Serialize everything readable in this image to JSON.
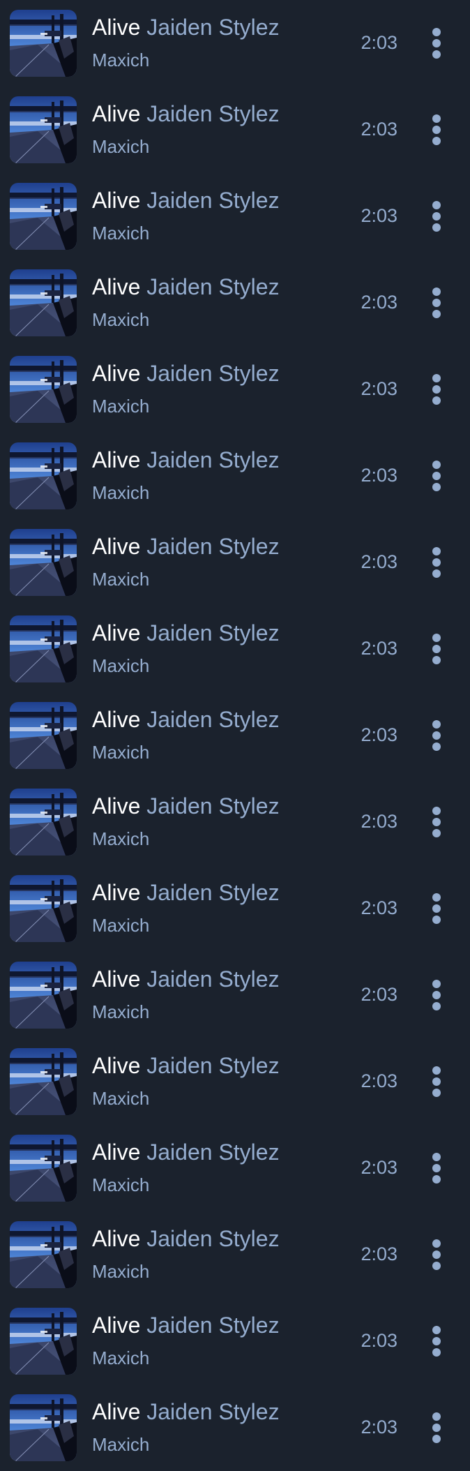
{
  "colors": {
    "background": "#1b222d",
    "title": "#ffffff",
    "secondary_text": "#95adcf"
  },
  "icons": {
    "more": "more-vertical-icon",
    "cover": "album-cover-highway"
  },
  "tracks": [
    {
      "title": "Alive",
      "featured": "Jaiden Stylez",
      "artist": "Maxich",
      "duration": "2:03"
    },
    {
      "title": "Alive",
      "featured": "Jaiden Stylez",
      "artist": "Maxich",
      "duration": "2:03"
    },
    {
      "title": "Alive",
      "featured": "Jaiden Stylez",
      "artist": "Maxich",
      "duration": "2:03"
    },
    {
      "title": "Alive",
      "featured": "Jaiden Stylez",
      "artist": "Maxich",
      "duration": "2:03"
    },
    {
      "title": "Alive",
      "featured": "Jaiden Stylez",
      "artist": "Maxich",
      "duration": "2:03"
    },
    {
      "title": "Alive",
      "featured": "Jaiden Stylez",
      "artist": "Maxich",
      "duration": "2:03"
    },
    {
      "title": "Alive",
      "featured": "Jaiden Stylez",
      "artist": "Maxich",
      "duration": "2:03"
    },
    {
      "title": "Alive",
      "featured": "Jaiden Stylez",
      "artist": "Maxich",
      "duration": "2:03"
    },
    {
      "title": "Alive",
      "featured": "Jaiden Stylez",
      "artist": "Maxich",
      "duration": "2:03"
    },
    {
      "title": "Alive",
      "featured": "Jaiden Stylez",
      "artist": "Maxich",
      "duration": "2:03"
    },
    {
      "title": "Alive",
      "featured": "Jaiden Stylez",
      "artist": "Maxich",
      "duration": "2:03"
    },
    {
      "title": "Alive",
      "featured": "Jaiden Stylez",
      "artist": "Maxich",
      "duration": "2:03"
    },
    {
      "title": "Alive",
      "featured": "Jaiden Stylez",
      "artist": "Maxich",
      "duration": "2:03"
    },
    {
      "title": "Alive",
      "featured": "Jaiden Stylez",
      "artist": "Maxich",
      "duration": "2:03"
    },
    {
      "title": "Alive",
      "featured": "Jaiden Stylez",
      "artist": "Maxich",
      "duration": "2:03"
    },
    {
      "title": "Alive",
      "featured": "Jaiden Stylez",
      "artist": "Maxich",
      "duration": "2:03"
    },
    {
      "title": "Alive",
      "featured": "Jaiden Stylez",
      "artist": "Maxich",
      "duration": "2:03"
    }
  ]
}
